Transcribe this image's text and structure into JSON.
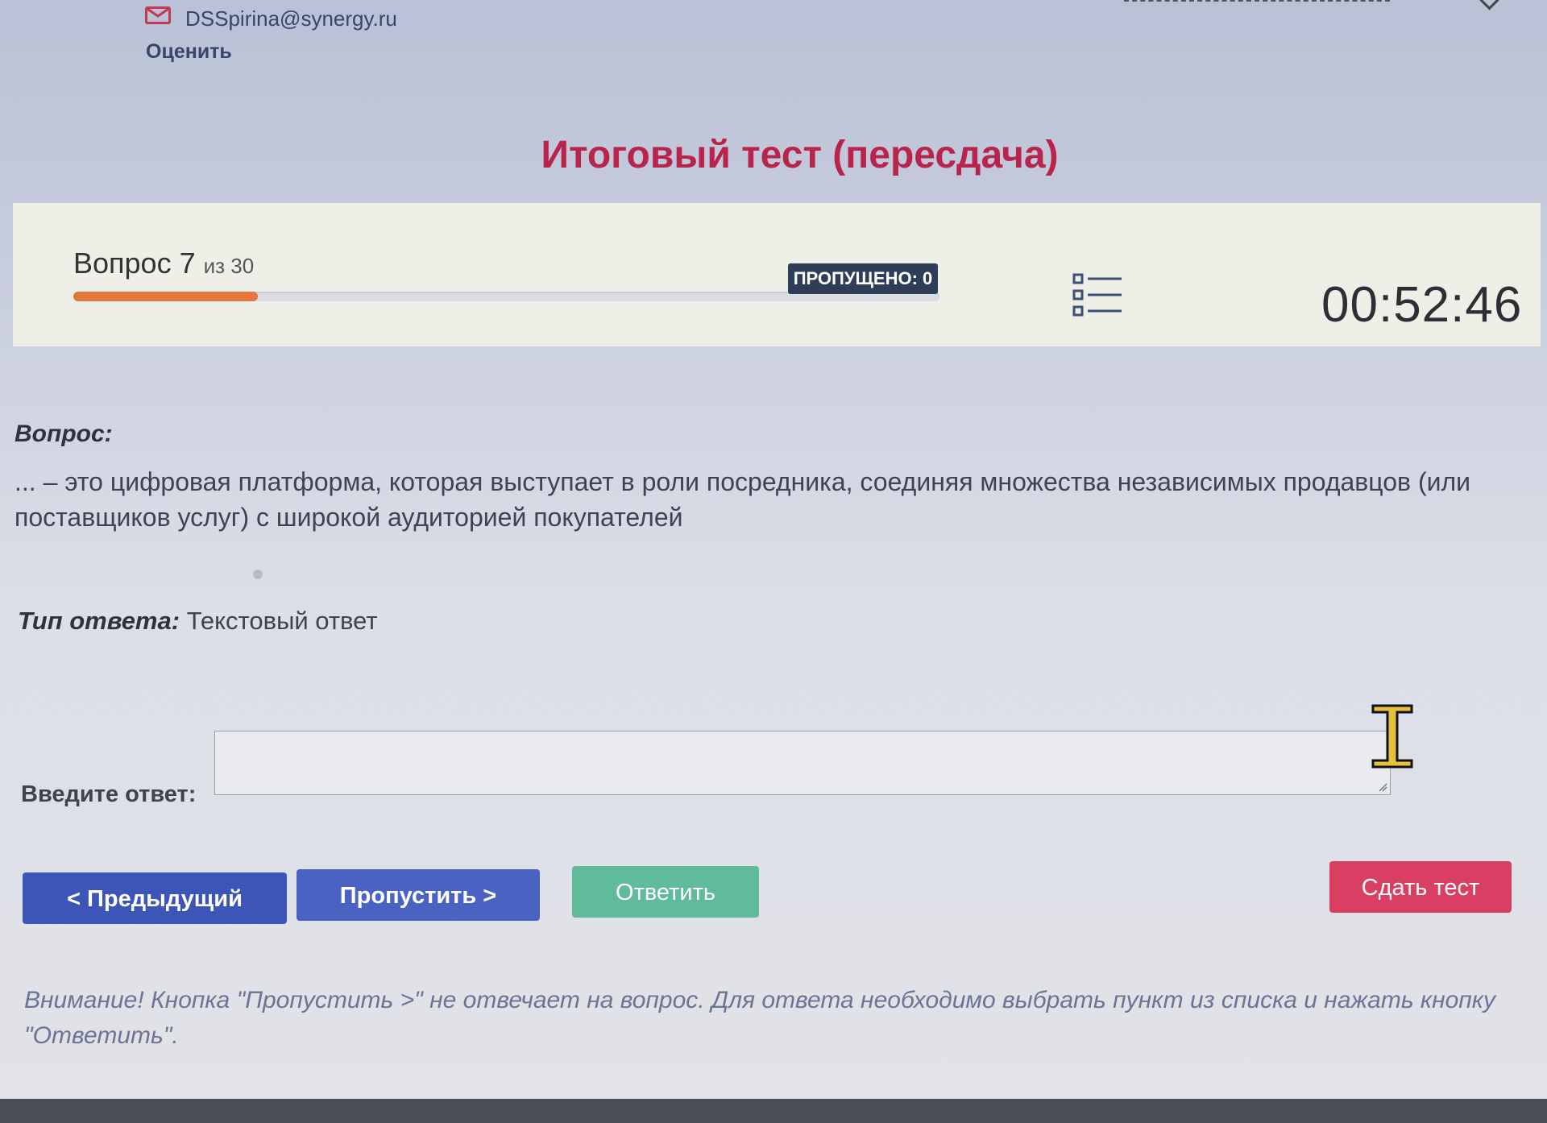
{
  "header": {
    "email": "DSSpirina@synergy.ru",
    "rate_label": "Оценить",
    "title": "Итоговый тест (пересдача)"
  },
  "status": {
    "question_word": "Вопрос",
    "question_number": "7",
    "question_total_text": "из 30",
    "progress_fraction": 0.2133,
    "skipped_badge": "ПРОПУЩЕНО: 0",
    "timer": "00:52:46",
    "list_icon": "question-list-icon"
  },
  "question": {
    "heading": "Вопрос:",
    "text": "... – это цифровая платформа, которая выступает в роли посредника, соединяя множества независимых продавцов (или поставщиков услуг) с широкой аудиторией покупателей"
  },
  "answer_type": {
    "label": "Тип ответа:",
    "value": "Текстовый ответ"
  },
  "answer": {
    "label": "Введите ответ:",
    "value": ""
  },
  "buttons": {
    "prev": "< Предыдущий",
    "skip": "Пропустить >",
    "answer": "Ответить",
    "submit": "Сдать тест"
  },
  "note": "Внимание! Кнопка \"Пропустить >\" не отвечает на вопрос. Для ответа необходимо выбрать пункт из списка и нажать кнопку \"Ответить\".",
  "colors": {
    "title": "#b8244b",
    "progress": "#e2763f",
    "badge": "#2e3d58",
    "prev_button": "#3e55b8",
    "skip_button": "#4a63c2",
    "answer_button": "#5fbb99",
    "submit_button": "#d93f63"
  }
}
